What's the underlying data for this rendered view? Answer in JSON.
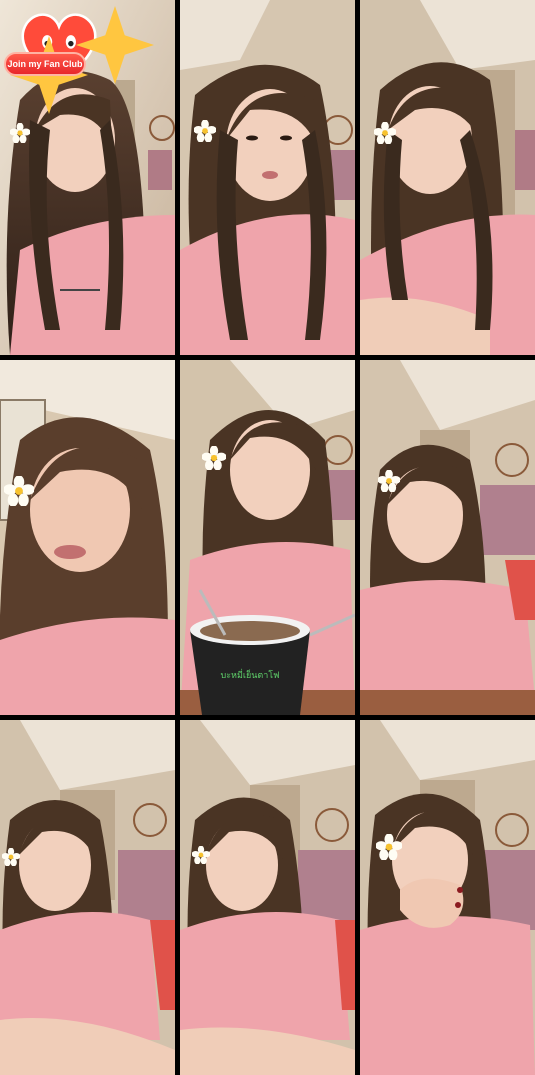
{
  "fan_club": {
    "label": "Join my Fan Club",
    "icon": "heart-mascot-icon",
    "colors": {
      "pill": "#e8262b",
      "heart": "#ff4b3a",
      "sparkle": "#ffc640"
    }
  },
  "overlay_icons": {
    "flower": "plumeria-flower-icon"
  },
  "palette": {
    "wall": "#d8c9b5",
    "ceiling": "#eee6da",
    "hair": "#4a3424",
    "skin": "#f0cdb8",
    "shirt": "#f1a7ae",
    "frame_bg": "#000000"
  },
  "bowl": {
    "label": "บะหมี่เย็นตาโฟ"
  }
}
